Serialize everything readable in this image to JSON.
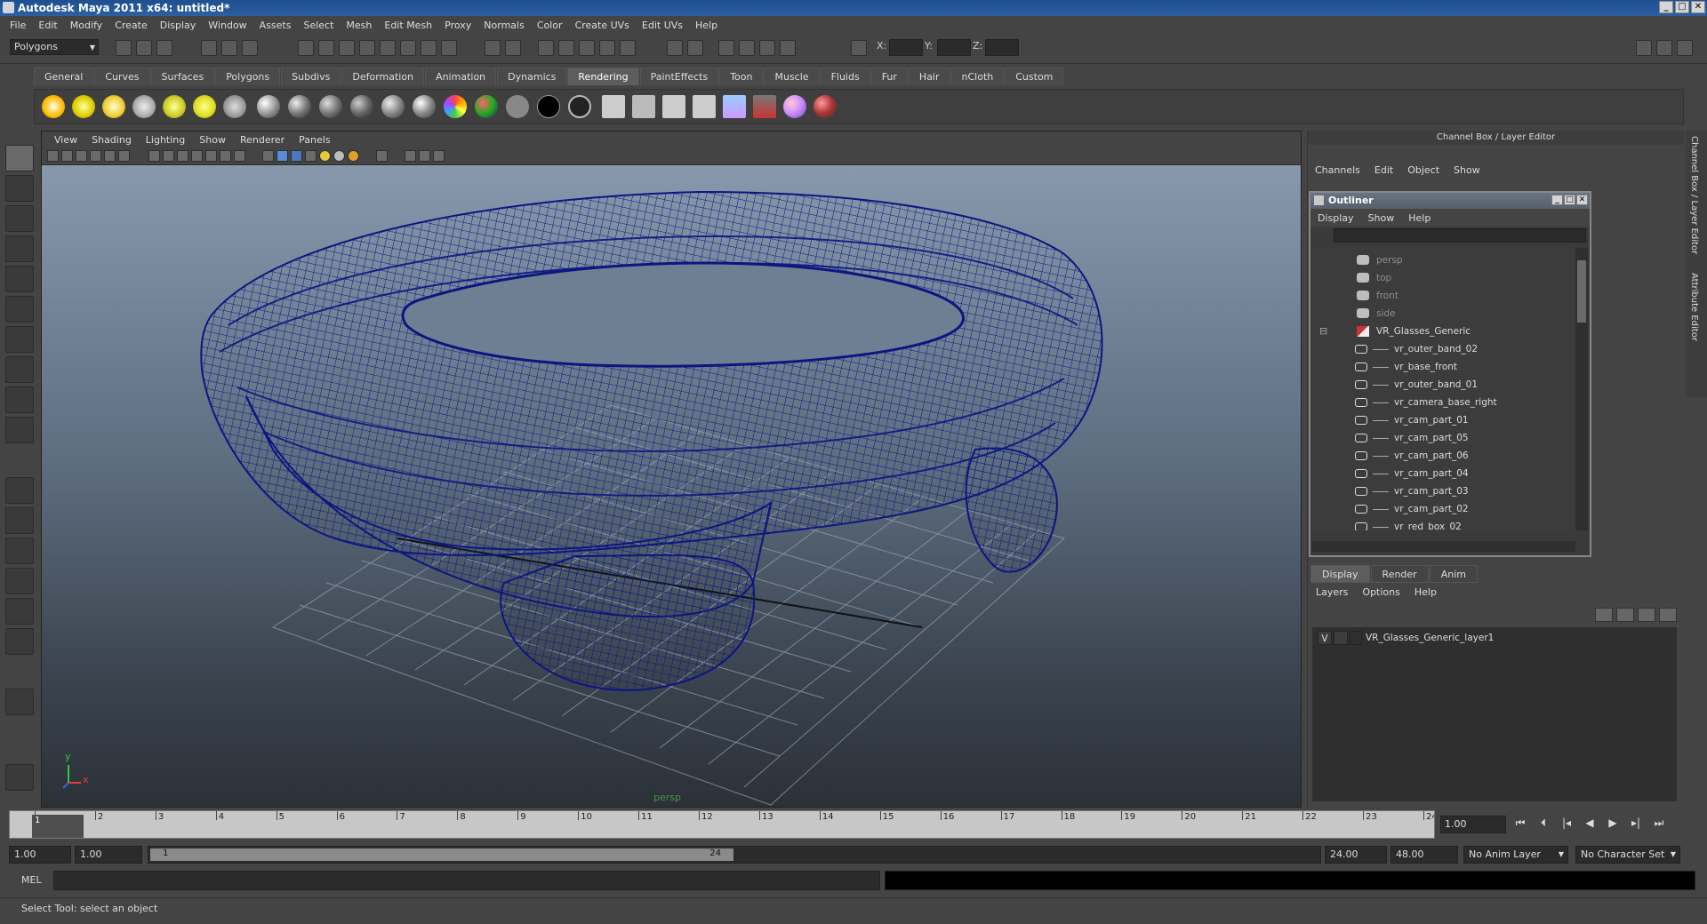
{
  "window": {
    "title": "Autodesk Maya 2011 x64: untitled*"
  },
  "menubar": [
    "File",
    "Edit",
    "Modify",
    "Create",
    "Display",
    "Window",
    "Assets",
    "Select",
    "Mesh",
    "Edit Mesh",
    "Proxy",
    "Normals",
    "Color",
    "Create UVs",
    "Edit UVs",
    "Help"
  ],
  "status_line": {
    "mode": "Polygons",
    "x_label": "X:",
    "y_label": "Y:",
    "z_label": "Z:"
  },
  "shelf": {
    "tabs": [
      "General",
      "Curves",
      "Surfaces",
      "Polygons",
      "Subdivs",
      "Deformation",
      "Animation",
      "Dynamics",
      "Rendering",
      "PaintEffects",
      "Toon",
      "Muscle",
      "Fluids",
      "Fur",
      "Hair",
      "nCloth",
      "Custom"
    ],
    "active_tab": "Rendering"
  },
  "viewport": {
    "menu": [
      "View",
      "Shading",
      "Lighting",
      "Show",
      "Renderer",
      "Panels"
    ],
    "camera_label": "persp",
    "axis_y": "y",
    "axis_x": "x",
    "wire_color": "#0c1680"
  },
  "channel_box": {
    "title": "Channel Box / Layer Editor",
    "menu": [
      "Channels",
      "Edit",
      "Object",
      "Show"
    ]
  },
  "outliner": {
    "title": "Outliner",
    "menu": [
      "Display",
      "Show",
      "Help"
    ],
    "items": [
      {
        "label": "persp",
        "kind": "camera",
        "dim": true
      },
      {
        "label": "top",
        "kind": "camera",
        "dim": true
      },
      {
        "label": "front",
        "kind": "camera",
        "dim": true
      },
      {
        "label": "side",
        "kind": "camera",
        "dim": true
      },
      {
        "label": "VR_Glasses_Generic",
        "kind": "group",
        "dim": false
      },
      {
        "label": "vr_outer_band_02",
        "kind": "mesh",
        "dim": false
      },
      {
        "label": "vr_base_front",
        "kind": "mesh",
        "dim": false
      },
      {
        "label": "vr_outer_band_01",
        "kind": "mesh",
        "dim": false
      },
      {
        "label": "vr_camera_base_right",
        "kind": "mesh",
        "dim": false
      },
      {
        "label": "vr_cam_part_01",
        "kind": "mesh",
        "dim": false
      },
      {
        "label": "vr_cam_part_05",
        "kind": "mesh",
        "dim": false
      },
      {
        "label": "vr_cam_part_06",
        "kind": "mesh",
        "dim": false
      },
      {
        "label": "vr_cam_part_04",
        "kind": "mesh",
        "dim": false
      },
      {
        "label": "vr_cam_part_03",
        "kind": "mesh",
        "dim": false
      },
      {
        "label": "vr_cam_part_02",
        "kind": "mesh",
        "dim": false
      },
      {
        "label": "vr_red_box_02",
        "kind": "mesh",
        "dim": false
      }
    ]
  },
  "layer_editor": {
    "tabs": [
      "Display",
      "Render",
      "Anim"
    ],
    "active_tab": "Display",
    "menu": [
      "Layers",
      "Options",
      "Help"
    ],
    "layer": {
      "visible": "V",
      "name": "VR_Glasses_Generic_layer1"
    }
  },
  "side_tabs": [
    "Channel Box / Layer Editor",
    "Attribute Editor"
  ],
  "time_slider": {
    "start": 1,
    "end": 24,
    "current_frame": "1",
    "current_time_field": "1.00"
  },
  "range_slider": {
    "start_time": "1.00",
    "playback_start": "1.00",
    "thumb_start": "1",
    "thumb_end": "24",
    "playback_end": "24.00",
    "end_time": "48.00",
    "anim_layer": "No Anim Layer",
    "character_set": "No Character Set"
  },
  "command_line": {
    "label": "MEL"
  },
  "help_line": {
    "text": "Select Tool: select an object"
  }
}
